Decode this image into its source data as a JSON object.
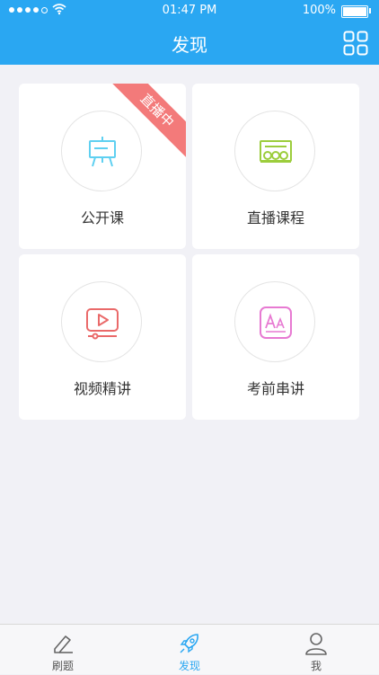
{
  "status_bar": {
    "time": "01:47 PM",
    "battery": "100%"
  },
  "header": {
    "title": "发现",
    "grid_icon": "grid-icon"
  },
  "cards": [
    {
      "label": "公开课",
      "icon": "easel-board-icon",
      "icon_color": "#5fd0f1",
      "badge": "直播中",
      "badge_color": "#f37a7a"
    },
    {
      "label": "直播课程",
      "icon": "live-classroom-icon",
      "icon_color": "#9ccd3c"
    },
    {
      "label": "视频精讲",
      "icon": "video-play-icon",
      "icon_color": "#ea6a6a"
    },
    {
      "label": "考前串讲",
      "icon": "font-aa-icon",
      "icon_color": "#e77ad2"
    }
  ],
  "tabbar": {
    "items": [
      {
        "label": "刷题",
        "icon": "pencil-icon",
        "active": false
      },
      {
        "label": "发现",
        "icon": "rocket-icon",
        "active": true
      },
      {
        "label": "我",
        "icon": "user-icon",
        "active": false
      }
    ]
  },
  "colors": {
    "primary": "#2aa7f2",
    "background": "#f1f1f6"
  }
}
